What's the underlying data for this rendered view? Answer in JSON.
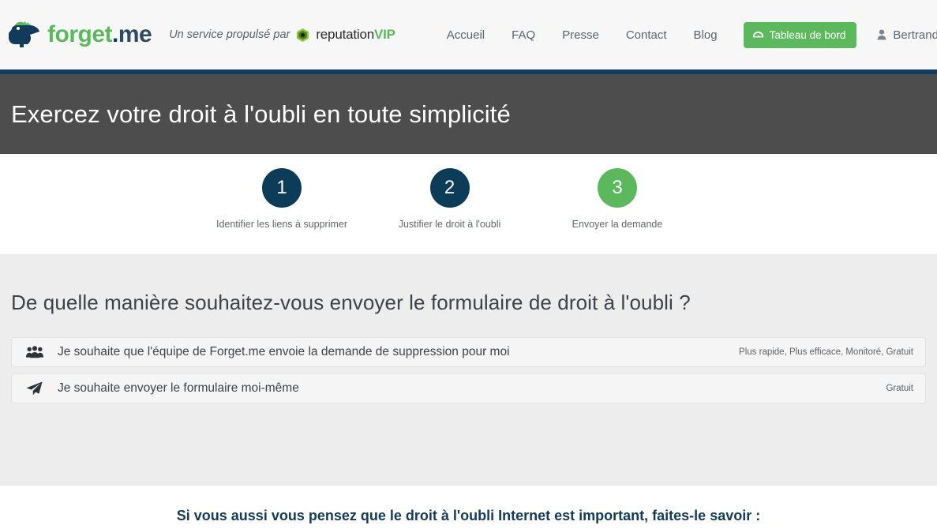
{
  "header": {
    "logo": {
      "word_part_1": "forget",
      "word_dot": ".",
      "word_part_2": "me",
      "icon_name": "forget-me-bird-logo"
    },
    "tagline": {
      "text": "Un service propulsé par",
      "partner_name": "reputation",
      "partner_suffix": "VIP",
      "partner_icon_name": "reputationvip-hex-icon"
    },
    "nav": [
      {
        "label": "Accueil"
      },
      {
        "label": "FAQ"
      },
      {
        "label": "Presse"
      },
      {
        "label": "Contact"
      },
      {
        "label": "Blog"
      }
    ],
    "dashboard_button": {
      "label": "Tableau de bord",
      "icon_name": "dashboard-gauge-icon",
      "color": "#5cb85c"
    },
    "user": {
      "name": "Bertrand ENJ...",
      "icon_name": "user-icon"
    },
    "language": {
      "flag_name": "flag-france",
      "caret_icon_name": "chevron-down-icon"
    },
    "rule_color": "#123a5a"
  },
  "banner": {
    "title": "Exercez votre droit à l'oubli en toute simplicité",
    "background": "#4d4d4d"
  },
  "steps": [
    {
      "number": "1",
      "label": "Identifier les liens à supprimer",
      "state": "navy",
      "color": "#0c3c58"
    },
    {
      "number": "2",
      "label": "Justifier le droit à l'oubli",
      "state": "navy",
      "color": "#0c3c58"
    },
    {
      "number": "3",
      "label": "Envoyer la demande",
      "state": "green",
      "color": "#5cb85c"
    }
  ],
  "question": {
    "title": "De quelle manière souhaitez-vous envoyer le formulaire de droit à l'oubli ?",
    "options": [
      {
        "icon_name": "users-group-icon",
        "text": "Je souhaite que l'équipe de Forget.me envoie la demande de suppression pour moi",
        "meta": "Plus rapide, Plus efficace, Monitoré, Gratuit"
      },
      {
        "icon_name": "paper-plane-icon",
        "text": "Je souhaite envoyer le formulaire moi-même",
        "meta": "Gratuit"
      }
    ]
  },
  "footer_cta": {
    "text": "Si vous aussi vous pensez que le droit à l'oubli Internet est important, faites-le savoir :",
    "color": "#123a5a"
  }
}
